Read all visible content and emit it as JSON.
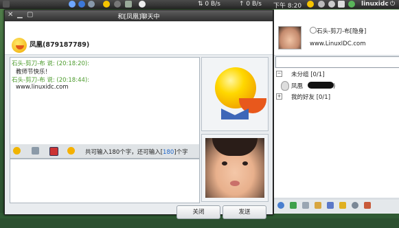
{
  "panel": {
    "net_down": "0 B/s",
    "net_up": "0 B/s",
    "clock": "下午 8:20",
    "user": "linuxidc",
    "colors": {
      "background": "#2d2d2d"
    }
  },
  "chat_window": {
    "title": "和[凤凰]聊天中",
    "contact": {
      "name": "凤凰(879187789)",
      "avatar_icon": "qq-smiley-avatar-icon"
    },
    "messages": [
      {
        "header": "石头-剪刀-布 说: (20:18:20):",
        "body": "教师节快乐！"
      },
      {
        "header": "石头-剪刀-布 说: (20:18:44):",
        "body": "www.linuxidc.com"
      }
    ],
    "toolbar": {
      "icons": [
        "emoticon-icon",
        "screenshot-icon",
        "font-icon",
        "wink-icon"
      ],
      "limit_text_prefix": "共可输入180个字，还可输入[",
      "limit_remaining": "180",
      "limit_text_suffix": "]个字"
    },
    "buttons": {
      "close": "关闭",
      "send": "发送"
    }
  },
  "buddy_panel": {
    "my_name": "石头-剪刀-布[隐身]",
    "signature": "www.LinuxIDC.com",
    "search_placeholder": "",
    "groups": [
      {
        "label": "未分组 [0/1]",
        "expanded": true,
        "buddies": [
          {
            "name_prefix": "凤凰",
            "name_suffix": ")"
          }
        ]
      },
      {
        "label": "我的好友 [0/1]",
        "expanded": false,
        "buddies": []
      }
    ],
    "bottom_icons": [
      "settings-icon",
      "add-icon",
      "message-icon",
      "mail-icon",
      "group-icon",
      "star-icon",
      "search-icon",
      "home-icon"
    ]
  }
}
